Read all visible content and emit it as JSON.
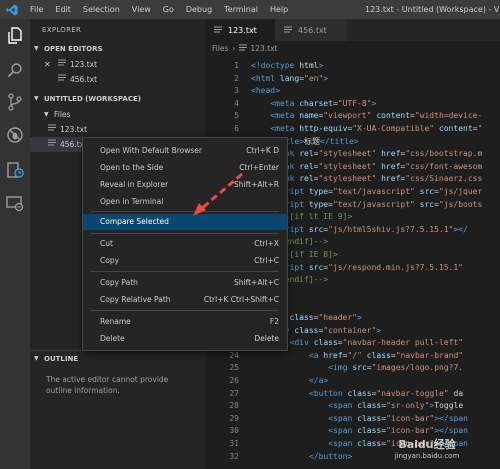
{
  "window": {
    "title": "123.txt - Untitled (Workspace) - Visual S",
    "menu": [
      "File",
      "Edit",
      "Selection",
      "View",
      "Go",
      "Debug",
      "Terminal",
      "Help"
    ]
  },
  "activity_bar": [
    "files-icon",
    "search-icon",
    "source-control-icon",
    "debug-icon",
    "extensions-icon",
    "remote-icon"
  ],
  "sidebar": {
    "title": "EXPLORER",
    "open_editors": {
      "header": "OPEN EDITORS",
      "items": [
        {
          "close": "✕",
          "name": "123.txt"
        },
        {
          "name": "456.txt"
        }
      ]
    },
    "workspace": {
      "header": "UNTITLED (WORKSPACE)",
      "folder": "Files",
      "files": [
        "123.txt",
        "456.txt"
      ]
    },
    "outline": {
      "header": "OUTLINE",
      "message": "The active editor cannot provide outline information."
    }
  },
  "tabs": [
    {
      "label": "123.txt",
      "active": true
    },
    {
      "label": "456.txt",
      "active": false
    }
  ],
  "breadcrumb": [
    "Files",
    "123.txt"
  ],
  "code_lines": [
    {
      "n": "1",
      "text": "<!doctype html>"
    },
    {
      "n": "2",
      "text": "<html lang=\"en\">"
    },
    {
      "n": "3",
      "text": "<head>"
    },
    {
      "n": "4",
      "text": "    <meta charset=\"UTF-8\">"
    },
    {
      "n": "5",
      "text": "    <meta name=\"viewport\" content=\"width=device-"
    },
    {
      "n": "6",
      "text": "    <meta http-equiv=\"X-UA-Compatible\" content=\""
    },
    {
      "n": "7",
      "text": "    <title>标题</title>"
    },
    {
      "n": "8",
      "text": "    <link rel=\"stylesheet\" href=\"css/bootstrap.m"
    },
    {
      "n": "9",
      "text": "    <link rel=\"stylesheet\" href=\"css/font-awesom"
    },
    {
      "n": "10",
      "text": "    <link rel=\"stylesheet\" href=\"css/Sinaerz.css"
    },
    {
      "n": "11",
      "text": "    <script type=\"text/javascript\" src=\"js/jquer"
    },
    {
      "n": "12",
      "text": "    <script type=\"text/javascript\" src=\"js/boots"
    },
    {
      "n": "13",
      "text": "    <!--[if lt IE 9]>"
    },
    {
      "n": "14",
      "text": "    <script src=\"js/html5shiv.js?7.5.15.1\"></"
    },
    {
      "n": "15",
      "text": "    <![endif]-->"
    },
    {
      "n": "16",
      "text": "    <!--[if IE 8]>"
    },
    {
      "n": "17",
      "text": "    <script src=\"js/respond.min.js?7.5.15.1\""
    },
    {
      "n": "18",
      "text": "    <![endif]-->"
    },
    {
      "n": "19",
      "text": ""
    },
    {
      "n": "20",
      "text": ""
    },
    {
      "n": "21",
      "text": "<header class=\"header\">"
    },
    {
      "n": "22",
      "text": "    <div class=\"container\">"
    },
    {
      "n": "23",
      "text": "        <div class=\"navbar-header pull-left\""
    },
    {
      "n": "24",
      "text": "            <a href=\"/\" class=\"navbar-brand\""
    },
    {
      "n": "25",
      "text": "                <img src=\"images/logo.png?7."
    },
    {
      "n": "26",
      "text": "            </a>"
    },
    {
      "n": "27",
      "text": "            <button class=\"navbar-toggle\" da"
    },
    {
      "n": "28",
      "text": "                <span class=\"sr-only\">Toggle"
    },
    {
      "n": "29",
      "text": "                <span class=\"icon-bar\"></span"
    },
    {
      "n": "30",
      "text": "                <span class=\"icon-bar\"></span"
    },
    {
      "n": "31",
      "text": "                <span class=\"icon-bar\"></span"
    },
    {
      "n": "32",
      "text": "            </button>"
    }
  ],
  "context_menu": [
    {
      "label": "Open With Default Browser",
      "key": "Ctrl+K D"
    },
    {
      "label": "Open to the Side",
      "key": "Ctrl+Enter"
    },
    {
      "label": "Reveal in Explorer",
      "key": "Shift+Alt+R"
    },
    {
      "label": "Open in Terminal",
      "key": ""
    },
    {
      "label": "Compare Selected",
      "key": "",
      "highlighted": true
    },
    {
      "label": "Cut",
      "key": "Ctrl+X"
    },
    {
      "label": "Copy",
      "key": "Ctrl+C"
    },
    {
      "label": "Copy Path",
      "key": "Shift+Alt+C"
    },
    {
      "label": "Copy Relative Path",
      "key": "Ctrl+K Ctrl+Shift+C"
    },
    {
      "label": "Rename",
      "key": "F2"
    },
    {
      "label": "Delete",
      "key": "Delete"
    }
  ],
  "watermark": {
    "brand": "Baidu经验",
    "url": "jingyan.baidu.com"
  },
  "colors": {
    "highlight": "#094771",
    "arrow": "#e74c3c",
    "tag": "#569cd6",
    "attr": "#9cdcfe",
    "string": "#ce9178"
  }
}
